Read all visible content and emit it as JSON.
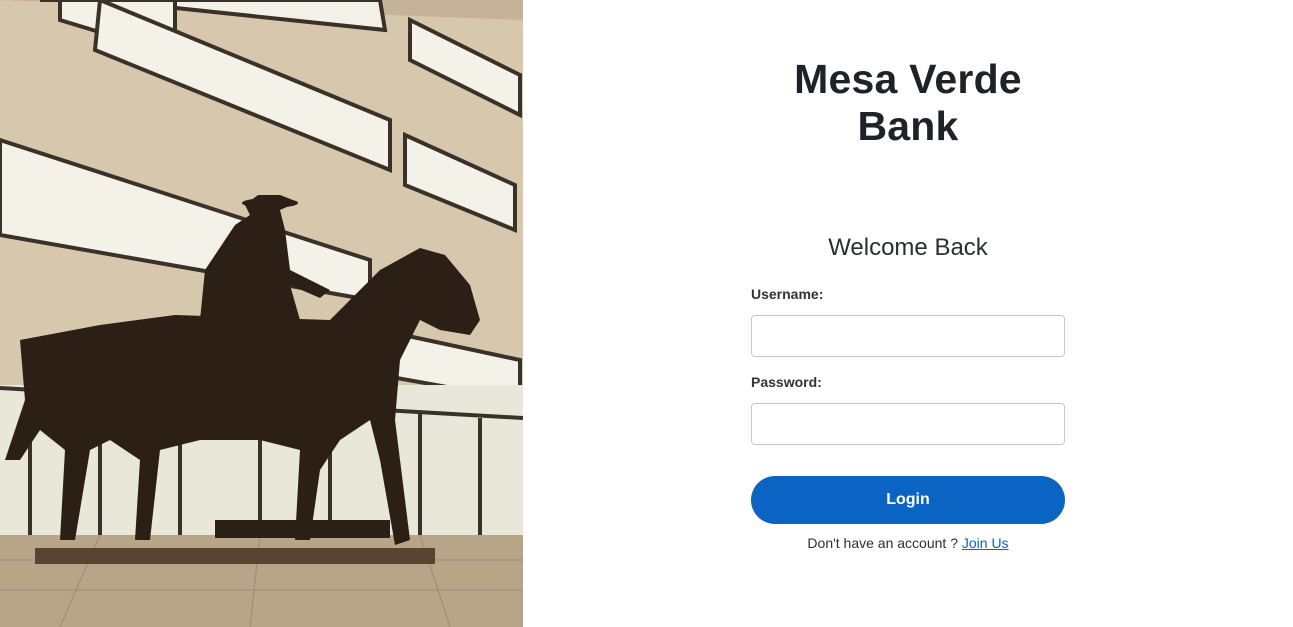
{
  "hero": {
    "image": "lobby-photo-cowboy-horse-silhouette",
    "colors": {
      "wall": "#d9cbb2",
      "window": "#f4f2ea",
      "silhouette": "#2b1f16",
      "floor": "#b9a68c"
    }
  },
  "bank": {
    "name": "Mesa Verde Bank"
  },
  "form": {
    "heading": "Welcome Back",
    "username_label": "Username:",
    "username_value": "",
    "password_label": "Password:",
    "password_value": "",
    "login_label": "Login",
    "signup_prompt": "Don't have an account ?",
    "signup_link": "Join Us"
  },
  "colors": {
    "accent": "#0b63c4",
    "text": "#1e2329"
  }
}
